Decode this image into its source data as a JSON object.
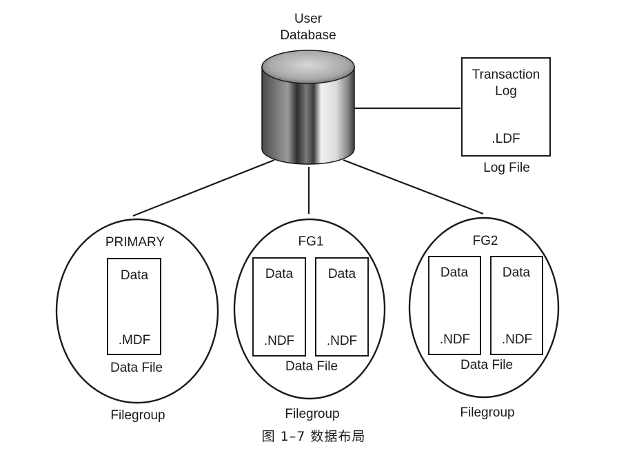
{
  "database": {
    "line1": "User",
    "line2": "Database"
  },
  "log": {
    "title_line1": "Transaction",
    "title_line2": "Log",
    "extension": ".LDF",
    "caption": "Log File"
  },
  "filegroups": [
    {
      "name": "PRIMARY",
      "files": [
        {
          "label": "Data",
          "extension": ".MDF"
        }
      ],
      "file_caption": "Data File",
      "caption": "Filegroup"
    },
    {
      "name": "FG1",
      "files": [
        {
          "label": "Data",
          "extension": ".NDF"
        },
        {
          "label": "Data",
          "extension": ".NDF"
        }
      ],
      "file_caption": "Data File",
      "caption": "Filegroup"
    },
    {
      "name": "FG2",
      "files": [
        {
          "label": "Data",
          "extension": ".NDF"
        },
        {
          "label": "Data",
          "extension": ".NDF"
        }
      ],
      "file_caption": "Data File",
      "caption": "Filegroup"
    }
  ],
  "figure_caption": "图 1–7   数据布局"
}
